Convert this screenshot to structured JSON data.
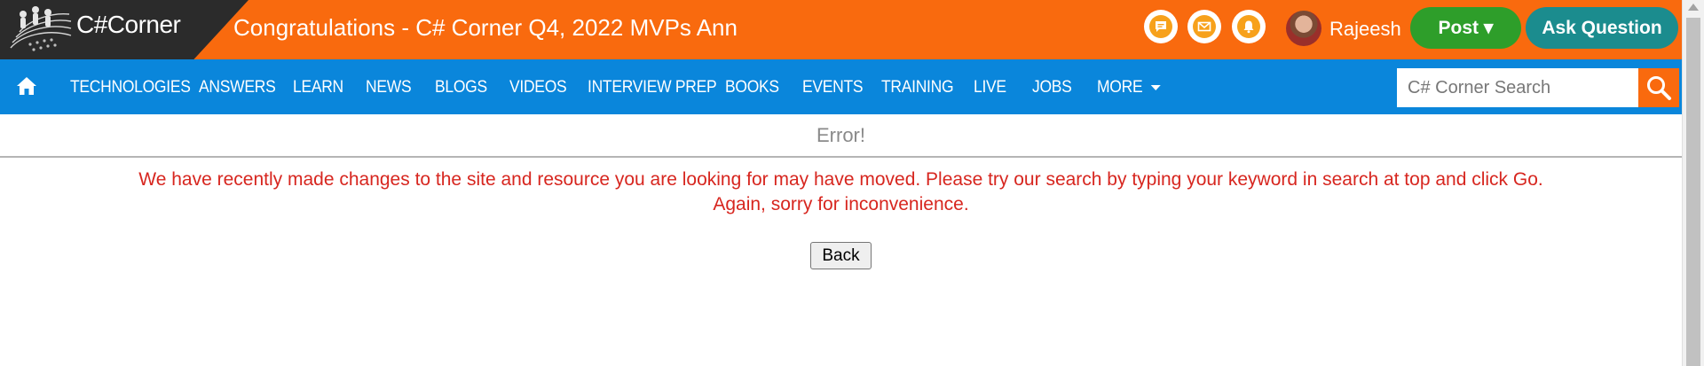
{
  "header": {
    "logo_text": "C#Corner",
    "announcement": "Congratulations - C# Corner Q4, 2022 MVPs Ann",
    "icons": [
      "chat-icon",
      "mail-icon",
      "bell-icon"
    ],
    "username": "Rajeesh",
    "post_label": "Post ▾",
    "ask_label": "Ask Question",
    "colors": {
      "header_bg": "#f96a0e",
      "logo_bg": "#2b2b2b",
      "post": "#2e9e2a",
      "ask": "#1b8c8e",
      "icon_accent": "#f7a11b"
    }
  },
  "nav": {
    "items": [
      "TECHNOLOGIES",
      "ANSWERS",
      "LEARN",
      "NEWS",
      "BLOGS",
      "VIDEOS",
      "INTERVIEW PREP",
      "BOOKS",
      "EVENTS",
      "TRAINING",
      "LIVE",
      "JOBS",
      "MORE"
    ],
    "search_placeholder": "C# Corner Search",
    "colors": {
      "nav_bg": "#0a86db"
    }
  },
  "content": {
    "error_title": "Error!",
    "message_line1": "We have recently made changes to the site and resource you are looking for may have moved. Please try our search by typing your keyword in search at top and click Go.",
    "message_line2": "Again, sorry for inconvenience.",
    "back_label": "Back",
    "colors": {
      "message": "#d7261f",
      "title": "#8a8a8a"
    }
  }
}
